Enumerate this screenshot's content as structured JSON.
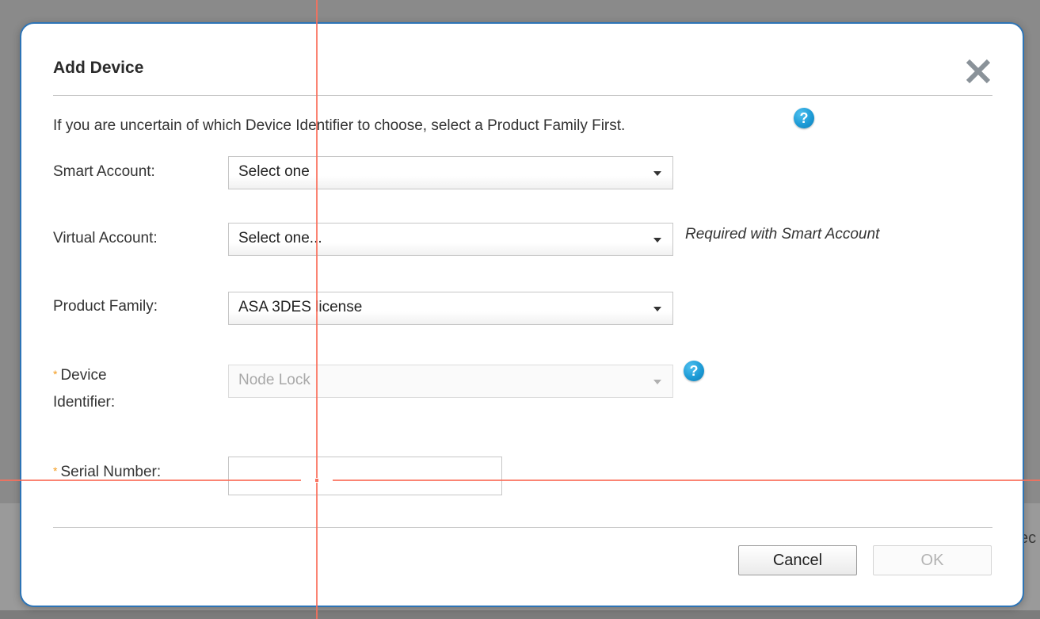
{
  "background": {
    "partial_text": "ec"
  },
  "dialog": {
    "title": "Add Device",
    "close_icon": "close-x-icon",
    "intro": "If you are uncertain of which Device Identifier to choose, select a Product Family First.",
    "help_icon_glyph": "?",
    "fields": {
      "smart_account": {
        "label": "Smart Account:",
        "value": "Select one"
      },
      "virtual_account": {
        "label": "Virtual Account:",
        "value": "Select one...",
        "hint": "Required with Smart Account"
      },
      "product_family": {
        "label": "Product Family:",
        "value": "ASA 3DES license"
      },
      "device_identifier": {
        "required_mark": "*",
        "label_line1": "Device",
        "label_line2": "Identifier:",
        "value": "Node Lock"
      },
      "serial_number": {
        "required_mark": "*",
        "label": "Serial Number:",
        "value": ""
      }
    },
    "buttons": {
      "cancel": "Cancel",
      "ok": "OK"
    }
  },
  "colors": {
    "accent_border": "#2d74b6",
    "required_star": "#f39a1b",
    "help_icon": "#1d9bd6"
  }
}
